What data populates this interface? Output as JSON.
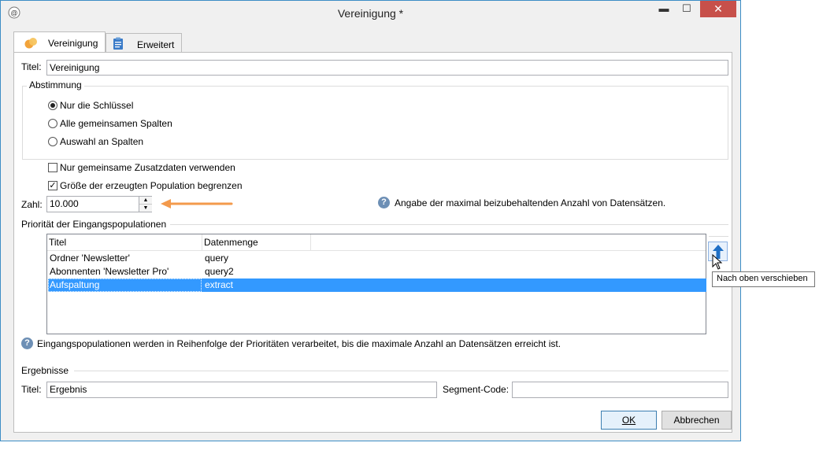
{
  "window": {
    "title": "Vereinigung *"
  },
  "window_controls": {
    "minimize": "▬",
    "maximize": "☐",
    "close": "✕"
  },
  "tabs": [
    {
      "label": "Vereinigung"
    },
    {
      "label": "Erweitert"
    }
  ],
  "titel_label": "Titel:",
  "titel_value": "Vereinigung",
  "abstimmung": {
    "label": "Abstimmung",
    "options": [
      "Nur die Schlüssel",
      "Alle gemeinsamen Spalten",
      "Auswahl an Spalten"
    ],
    "selected_index": 0
  },
  "checkboxes": [
    {
      "label": "Nur gemeinsame Zusatzdaten verwenden",
      "checked": false
    },
    {
      "label": "Größe der erzeugten Population begrenzen",
      "checked": true
    }
  ],
  "zahl": {
    "label": "Zahl:",
    "value": "10.000"
  },
  "zahl_help": "Angabe der maximal beizubehaltenden Anzahl von Datensätzen.",
  "prioritaet": {
    "label": "Priorität der Eingangspopulationen",
    "columns": [
      "Titel",
      "Datenmenge"
    ],
    "rows": [
      {
        "titel": "Ordner 'Newsletter'",
        "datenmenge": "query"
      },
      {
        "titel": "Abonnenten 'Newsletter Pro'",
        "datenmenge": "query2"
      },
      {
        "titel": "Aufspaltung",
        "datenmenge": "extract"
      }
    ],
    "selected_row": 2
  },
  "tooltip": "Nach oben verschieben",
  "info_text": "Eingangspopulationen werden in Reihenfolge der Prioritäten verarbeitet, bis die maximale Anzahl an Datensätzen erreicht ist.",
  "ergebnisse": {
    "label": "Ergebnisse",
    "titel_label": "Titel:",
    "titel_value": "Ergebnis",
    "segment_label": "Segment-Code:",
    "segment_value": ""
  },
  "buttons": {
    "ok": "OK",
    "cancel": "Abbrechen"
  },
  "colors": {
    "accent_arrow": "#f39a4c",
    "selection": "#3399ff",
    "close_button": "#c7504a"
  },
  "icons": {
    "app": "app-icon",
    "tab_vereinigung": "union-circles-icon",
    "tab_erweitert": "clipboard-icon",
    "help": "help-icon",
    "move_up": "arrow-up-icon",
    "annotation": "arrow-left-icon",
    "cursor": "mouse-pointer-icon"
  }
}
